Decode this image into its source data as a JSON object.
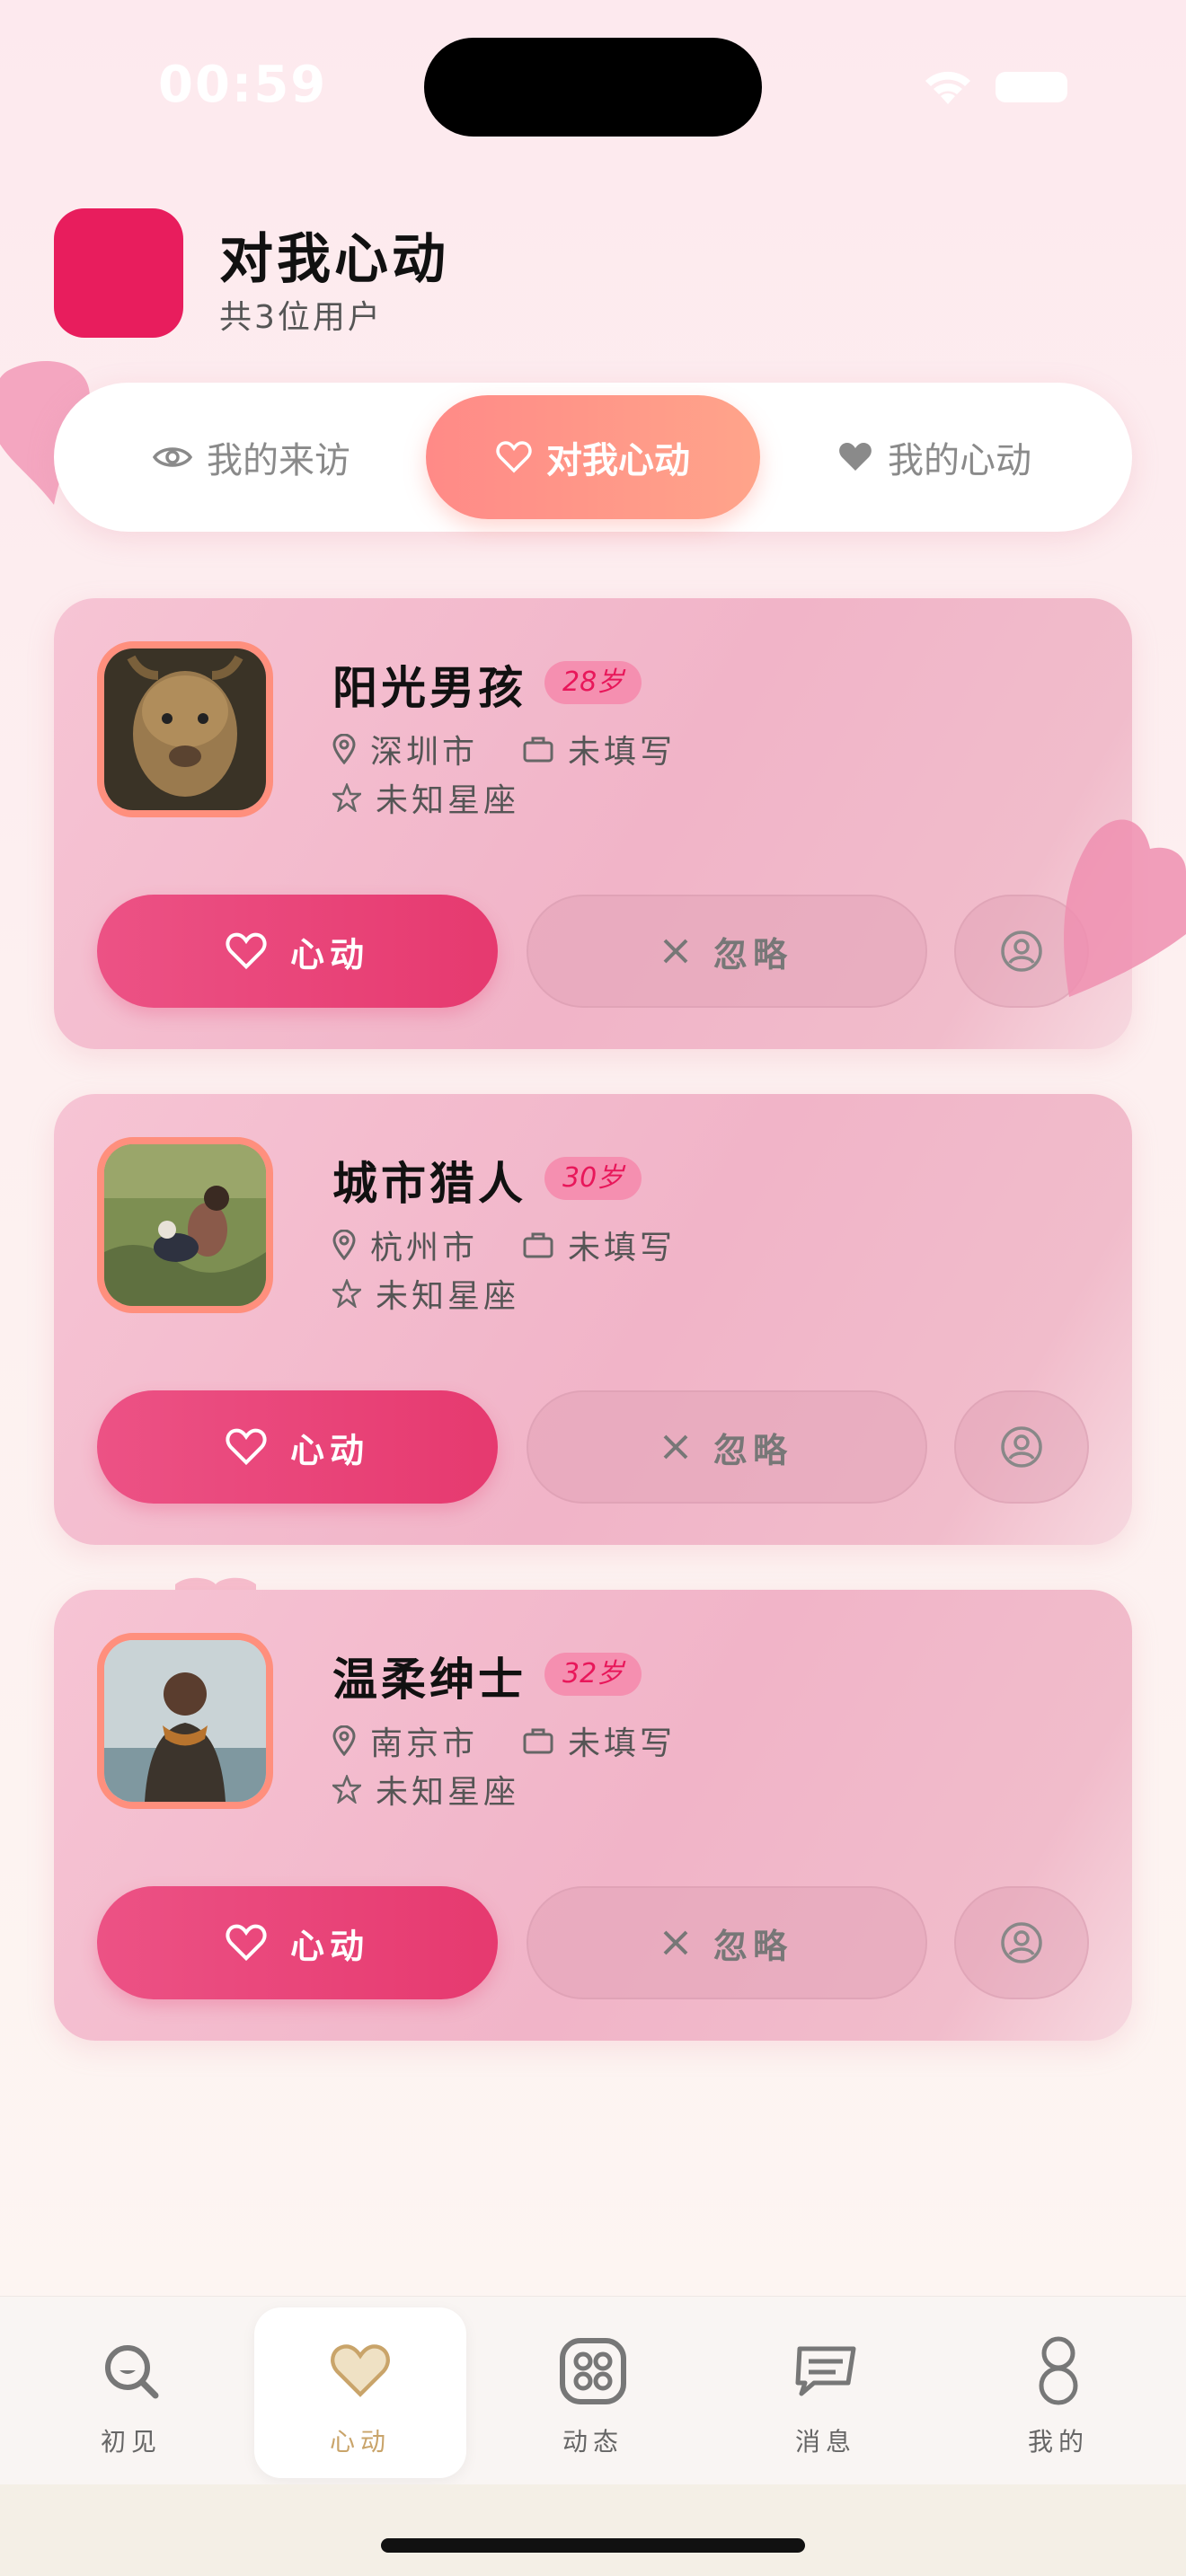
{
  "status_bar": {
    "time": "00:59"
  },
  "header": {
    "title": "对我心动",
    "subtitle": "共3位用户"
  },
  "tabs": [
    {
      "label": "我的来访",
      "icon": "eye-icon",
      "active": false
    },
    {
      "label": "对我心动",
      "icon": "heart-outline-icon",
      "active": true
    },
    {
      "label": "我的心动",
      "icon": "heart-filled-icon",
      "active": false
    }
  ],
  "users": [
    {
      "name": "阳光男孩",
      "age": "28岁",
      "city": "深圳市",
      "job": "未填写",
      "zodiac": "未知星座",
      "photo": "lion-photo"
    },
    {
      "name": "城市猎人",
      "age": "30岁",
      "city": "杭州市",
      "job": "未填写",
      "zodiac": "未知星座",
      "photo": "grass-couple-photo"
    },
    {
      "name": "温柔绅士",
      "age": "32岁",
      "city": "南京市",
      "job": "未填写",
      "zodiac": "未知星座",
      "photo": "man-scarf-photo"
    }
  ],
  "actions": {
    "like_label": "心动",
    "ignore_label": "忽略"
  },
  "nav": [
    {
      "label": "初见",
      "icon": "search-face-icon",
      "active": false
    },
    {
      "label": "心动",
      "icon": "heart-icon",
      "active": true
    },
    {
      "label": "动态",
      "icon": "grid-dots-icon",
      "active": false
    },
    {
      "label": "消息",
      "icon": "message-icon",
      "active": false
    },
    {
      "label": "我的",
      "icon": "figure-eight-icon",
      "active": false
    }
  ],
  "colors": {
    "primary": "#e81d5d",
    "tab_active_start": "#ff8a87",
    "like_button": "#e6396f",
    "nav_active": "#c9a46a"
  }
}
